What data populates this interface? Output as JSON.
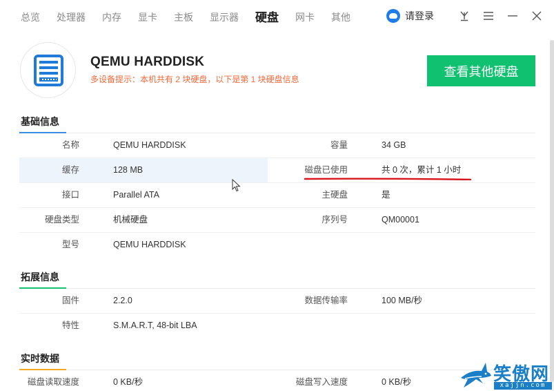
{
  "nav": {
    "items": [
      {
        "label": "总览",
        "active": false
      },
      {
        "label": "处理器",
        "active": false
      },
      {
        "label": "内存",
        "active": false
      },
      {
        "label": "显卡",
        "active": false
      },
      {
        "label": "主板",
        "active": false
      },
      {
        "label": "显示器",
        "active": false
      },
      {
        "label": "硬盘",
        "active": true
      },
      {
        "label": "网卡",
        "active": false
      },
      {
        "label": "其他",
        "active": false
      }
    ],
    "login_label": "请登录"
  },
  "header": {
    "disk_name": "QEMU HARDDISK",
    "tip": "多设备提示：本机共有 2 块硬盘，以下是第 1 块硬盘信息",
    "other_disk_button": "查看其他硬盘"
  },
  "basic": {
    "title": "基础信息",
    "rows": [
      {
        "l_label": "名称",
        "l_value": "QEMU HARDDISK",
        "r_label": "容量",
        "r_value": "34 GB"
      },
      {
        "l_label": "缓存",
        "l_value": "128 MB",
        "r_label": "磁盘已使用",
        "r_value": "共 0 次，累计 1 小时"
      },
      {
        "l_label": "接口",
        "l_value": "Parallel ATA",
        "r_label": "主硬盘",
        "r_value": "是"
      },
      {
        "l_label": "硬盘类型",
        "l_value": "机械硬盘",
        "r_label": "序列号",
        "r_value": "QM00001"
      },
      {
        "l_label": "型号",
        "l_value": "QEMU HARDDISK",
        "r_label": "",
        "r_value": ""
      }
    ]
  },
  "extended": {
    "title": "拓展信息",
    "rows": [
      {
        "l_label": "固件",
        "l_value": "2.2.0",
        "r_label": "数据传输率",
        "r_value": "100 MB/秒"
      },
      {
        "l_label": "特性",
        "l_value": "S.M.A.R.T, 48-bit LBA",
        "r_label": "",
        "r_value": ""
      }
    ]
  },
  "realtime": {
    "title": "实时数据",
    "rows": [
      {
        "l_label": "磁盘读取速度",
        "l_value": "0 KB/秒",
        "r_label": "磁盘写入速度",
        "r_value": "0 KB/秒"
      }
    ]
  },
  "watermark": {
    "text": "笑傲网",
    "domain": "xajjn.com"
  },
  "colors": {
    "accent_green": "#10c16f",
    "tip_orange": "#f06a3a",
    "icon_blue": "#1f7ad8",
    "section_blue": "#3b8ee8",
    "section_green": "#10c16f",
    "section_orange": "#f5a623",
    "annotation_red": "#d8141c"
  }
}
